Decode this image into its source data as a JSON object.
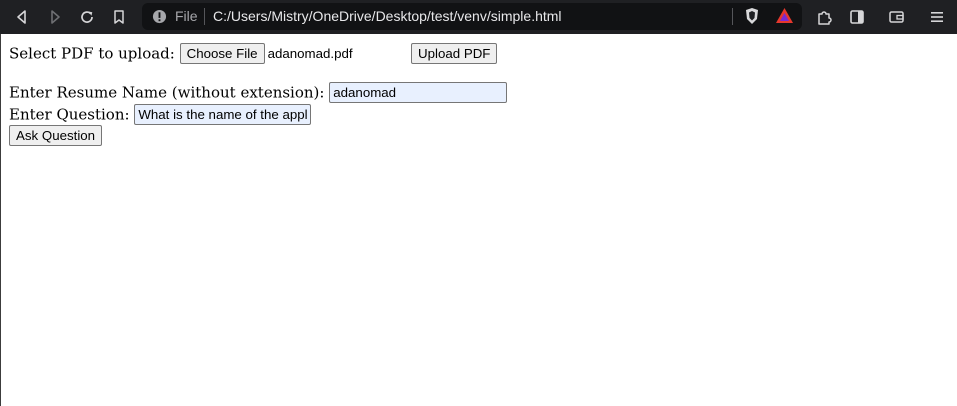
{
  "browser": {
    "file_label": "File",
    "url": "C:/Users/Mistry/OneDrive/Desktop/test/venv/simple.html",
    "icons": [
      "back-icon",
      "forward-icon",
      "reload-icon",
      "bookmark-icon",
      "info-icon",
      "brave-shield-icon",
      "brave-rewards-icon",
      "extensions-icon",
      "sidebar-icon",
      "wallet-icon",
      "menu-icon"
    ]
  },
  "upload": {
    "label": "Select PDF to upload:",
    "choose_button": "Choose File",
    "file_name": "adanomad.pdf",
    "upload_button": "Upload PDF"
  },
  "ask": {
    "resume_label": "Enter Resume Name (without extension):",
    "resume_value": "adanomad",
    "question_label": "Enter Question:",
    "question_value": "What is the name of the appl",
    "ask_button": "Ask Question"
  }
}
